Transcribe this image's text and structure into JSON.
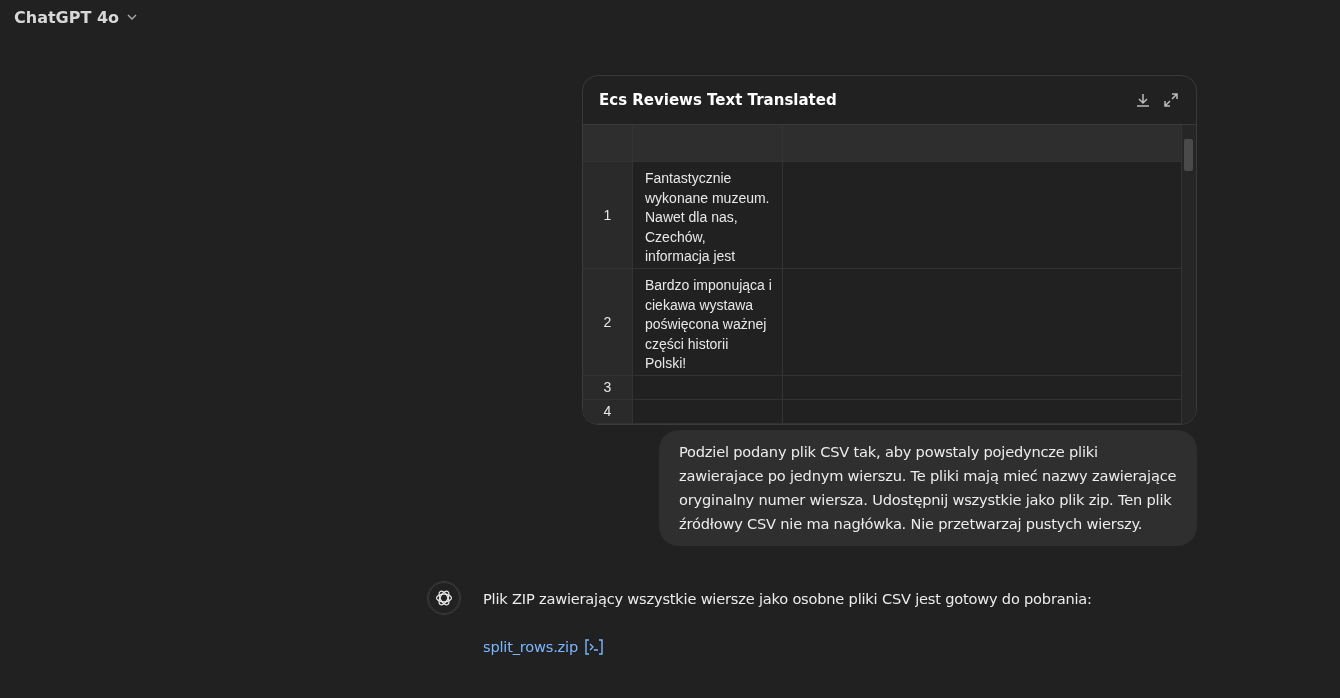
{
  "header": {
    "model": "ChatGPT 4o"
  },
  "table_card": {
    "title": "Ecs Reviews Text Translated",
    "rows": [
      {
        "index": "1",
        "text": "Fantastycznie wykonane muzeum. Nawet dla nas, Czechów, informacja jest"
      },
      {
        "index": "2",
        "text": "Bardzo imponująca i ciekawa wystawa poświęcona ważnej części historii Polski!"
      },
      {
        "index": "3",
        "text": ""
      },
      {
        "index": "4",
        "text": ""
      }
    ]
  },
  "user_message": "Podziel podany plik CSV tak, aby powstaly pojedyncze pliki zawierajace po jednym wierszu. Te pliki mają mieć nazwy zawierające oryginalny numer wiersza. Udostępnij wszystkie jako plik zip. Ten plik źródłowy CSV nie ma nagłówka. Nie przetwarzaj pustych wierszy.",
  "assistant_message": {
    "text": "Plik ZIP zawierający wszystkie wiersze jako osobne pliki CSV jest gotowy do pobrania:",
    "link": "split_rows.zip"
  }
}
